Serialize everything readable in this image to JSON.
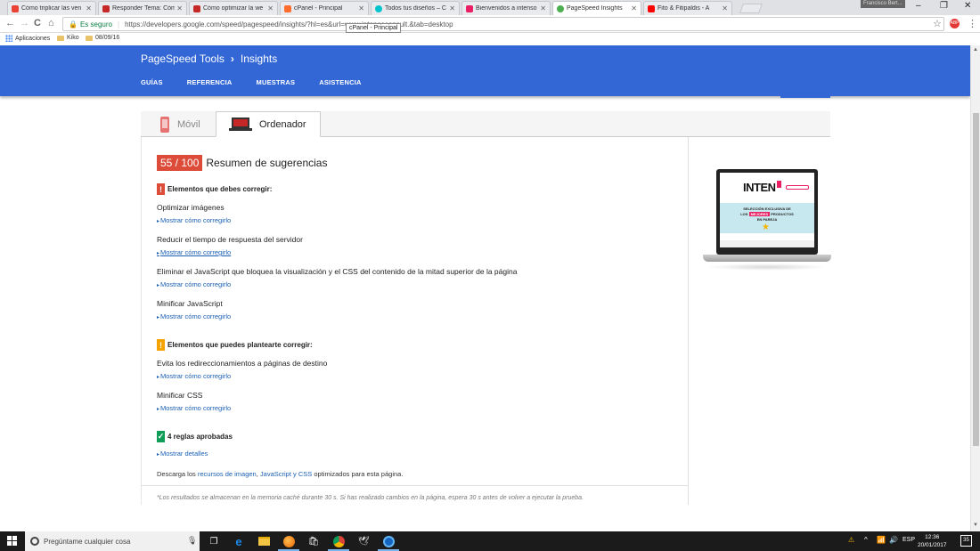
{
  "browser": {
    "tabs": [
      {
        "title": "Cómo triplicar las ven",
        "color": "#ea4335"
      },
      {
        "title": "Responder Tema: Cóm",
        "color": "#c62828"
      },
      {
        "title": "Cómo optimizar la we",
        "color": "#c62828"
      },
      {
        "title": "cPanel - Principal",
        "color": "#ff6c2c"
      },
      {
        "title": "Todos tus diseños – C",
        "color": "#00c4cc"
      },
      {
        "title": "Bienvenidos a intenso",
        "color": "#e91e63"
      },
      {
        "title": "PageSpeed Insights",
        "color": "#4caf50"
      },
      {
        "title": "Fito & Fitipaldis - A",
        "color": "#ff0000"
      }
    ],
    "user_badge": "Francisco Bert...",
    "window_controls": {
      "minimize": "–",
      "restore": "❐",
      "close": "✕"
    },
    "nav": {
      "back": "←",
      "forward": "→",
      "reload": "C",
      "home": "⌂"
    },
    "omnibox": {
      "secure_label": "Es seguro",
      "url": "https://developers.google.com/speed/pagespeed/insights/?hl=es&url=www.intensoconsult.&tab=desktop"
    },
    "star": "☆",
    "extension_badge": "ABP",
    "menu": "⋮",
    "tooltip": "cPanel - Principal",
    "bookmarks": [
      {
        "label": "Aplicaciones",
        "type": "apps"
      },
      {
        "label": "Kiko",
        "type": "folder"
      },
      {
        "label": "08/09/16",
        "type": "folder"
      }
    ]
  },
  "pagespeed": {
    "header": {
      "tools": "PageSpeed Tools",
      "chevron": "›",
      "product": "Insights"
    },
    "nav": [
      "GUÍAS",
      "REFERENCIA",
      "MUESTRAS",
      "ASISTENCIA"
    ],
    "device_tabs": {
      "mobile": "Móvil",
      "desktop": "Ordenador"
    },
    "score": {
      "value": "55 / 100",
      "label": "Resumen de sugerencias"
    },
    "must_fix": {
      "icon": "!",
      "title": "Elementos que debes corregir:",
      "rules": [
        {
          "name": "Optimizar imágenes",
          "link": "Mostrar cómo corregirlo"
        },
        {
          "name": "Reducir el tiempo de respuesta del servidor",
          "link": "Mostrar cómo corregirlo"
        },
        {
          "name": "Eliminar el JavaScript que bloquea la visualización y el CSS del contenido de la mitad superior de la página",
          "link": "Mostrar cómo corregirlo"
        },
        {
          "name": "Minificar JavaScript",
          "link": "Mostrar cómo corregirlo"
        }
      ]
    },
    "should_fix": {
      "icon": "!",
      "title": "Elementos que puedes plantearte corregir:",
      "rules": [
        {
          "name": "Evita los redireccionamientos a páginas de destino",
          "link": "Mostrar cómo corregirlo"
        },
        {
          "name": "Minificar CSS",
          "link": "Mostrar cómo corregirlo"
        }
      ]
    },
    "passed": {
      "icon": "✓",
      "title": "4 reglas aprobadas",
      "link": "Mostrar detalles"
    },
    "download": {
      "prefix": "Descarga los ",
      "link1": "recursos de imagen",
      "sep": ", ",
      "link2": "JavaScript y CSS",
      "suffix": " optimizados para esta página."
    },
    "footnote": "*Los resultados se almacenan en la memoria caché durante 30 s. Si has realizado cambios en la página, espera 30 s antes de volver a ejecutar la prueba.",
    "preview": {
      "logo": "INTEN",
      "line1": "SELECCIÓN EXCLUSIVA DE",
      "line2_pre": "LOS ",
      "line2_hl": "MEJORES",
      "line2_post": " PRODUCTOS",
      "line3": "EN PAREJA"
    }
  },
  "taskbar": {
    "search_placeholder": "Pregúntame cualquier cosa",
    "mic": "🎙",
    "apps": [
      "task-view",
      "edge",
      "file-explorer",
      "firefox",
      "store",
      "chrome",
      "app-bird",
      "app-circle"
    ],
    "tray": {
      "up": "^",
      "lang": "ESP"
    },
    "time": "12:36",
    "date": "20/01/2017",
    "notifications": "35"
  }
}
